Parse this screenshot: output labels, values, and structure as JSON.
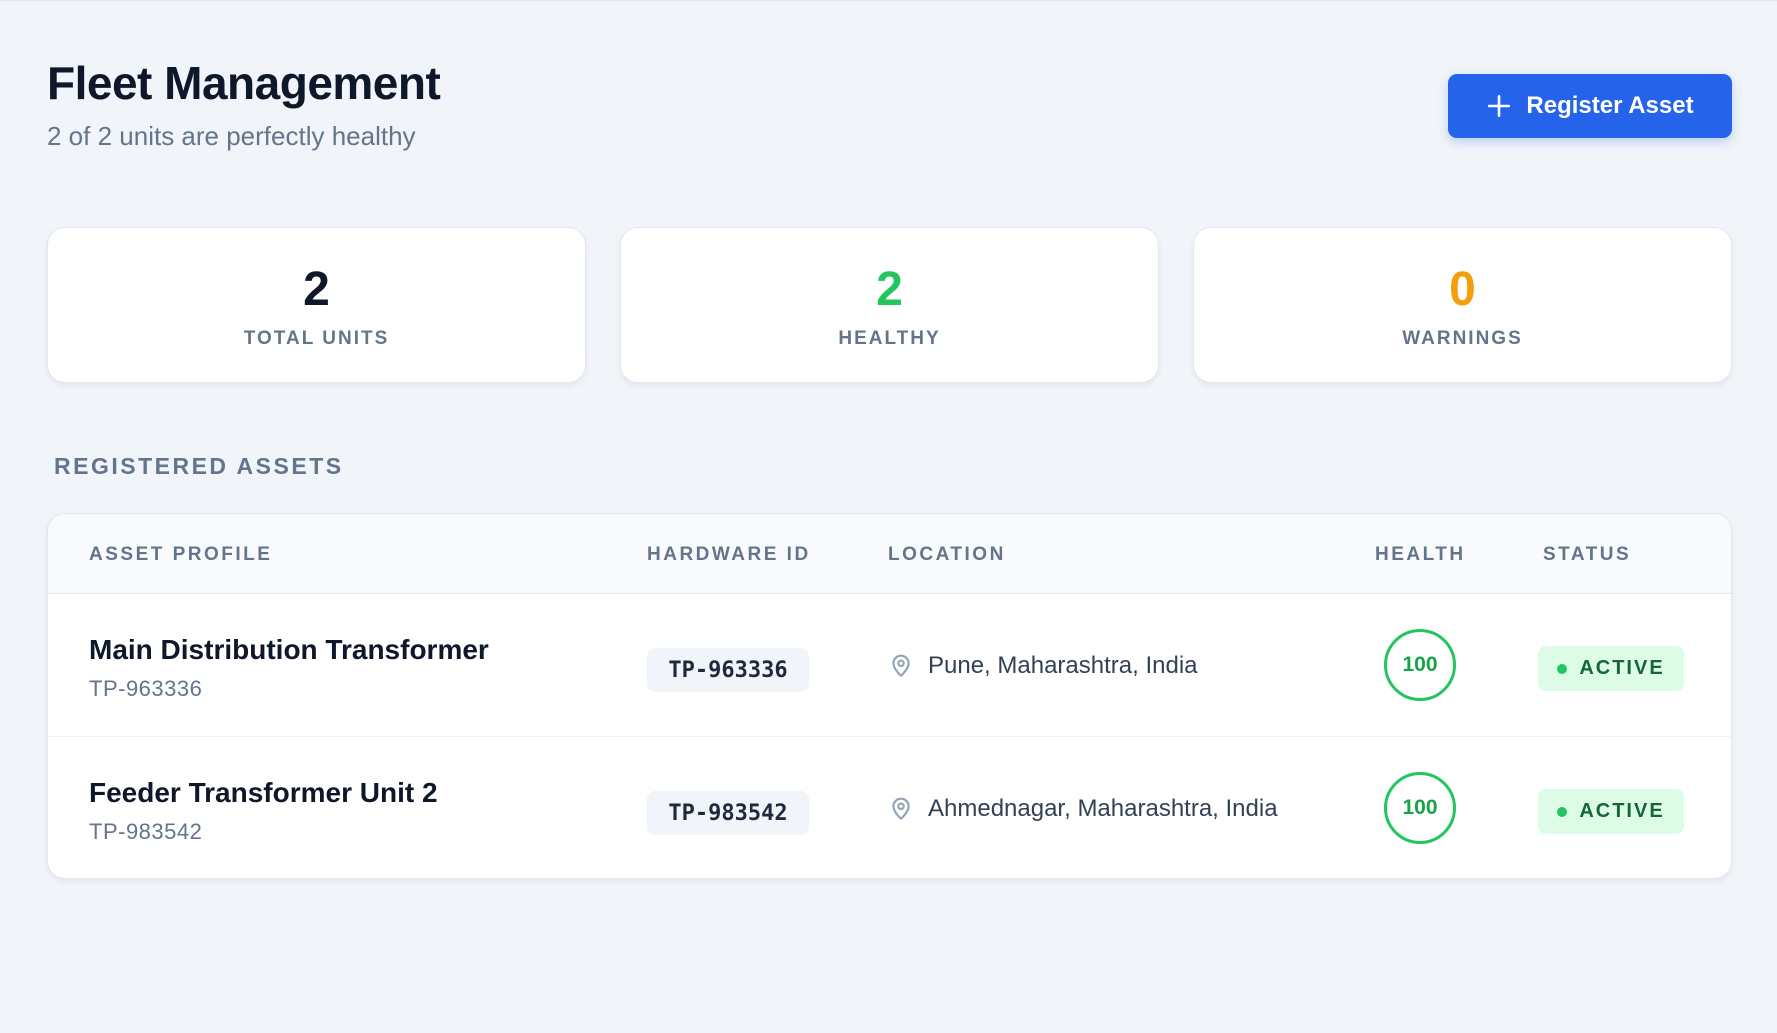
{
  "header": {
    "title": "Fleet Management",
    "subtitle": "2 of 2 units are perfectly healthy",
    "register_button_label": "Register Asset"
  },
  "stats": [
    {
      "value": "2",
      "label": "TOTAL UNITS",
      "color": "#0f172a"
    },
    {
      "value": "2",
      "label": "HEALTHY",
      "color": "#22c55e"
    },
    {
      "value": "0",
      "label": "WARNINGS",
      "color": "#f59e0b"
    }
  ],
  "section_title": "REGISTERED ASSETS",
  "table": {
    "columns": [
      "ASSET PROFILE",
      "HARDWARE ID",
      "LOCATION",
      "HEALTH",
      "STATUS"
    ],
    "rows": [
      {
        "name": "Main Distribution Transformer",
        "code": "TP-963336",
        "hardware_id": "TP-963336",
        "location": "Pune, Maharashtra, India",
        "health": "100",
        "status": "ACTIVE"
      },
      {
        "name": "Feeder Transformer Unit 2",
        "code": "TP-983542",
        "hardware_id": "TP-983542",
        "location": "Ahmednagar, Maharashtra, India",
        "health": "100",
        "status": "ACTIVE"
      }
    ]
  },
  "icons": {
    "register": "plus-icon",
    "location": "map-pin-icon",
    "status": "status-dot-icon"
  },
  "colors": {
    "accent": "#2563eb",
    "healthy": "#22c55e",
    "warning": "#f59e0b",
    "badge_bg": "#dcfce7",
    "badge_text": "#166534"
  }
}
